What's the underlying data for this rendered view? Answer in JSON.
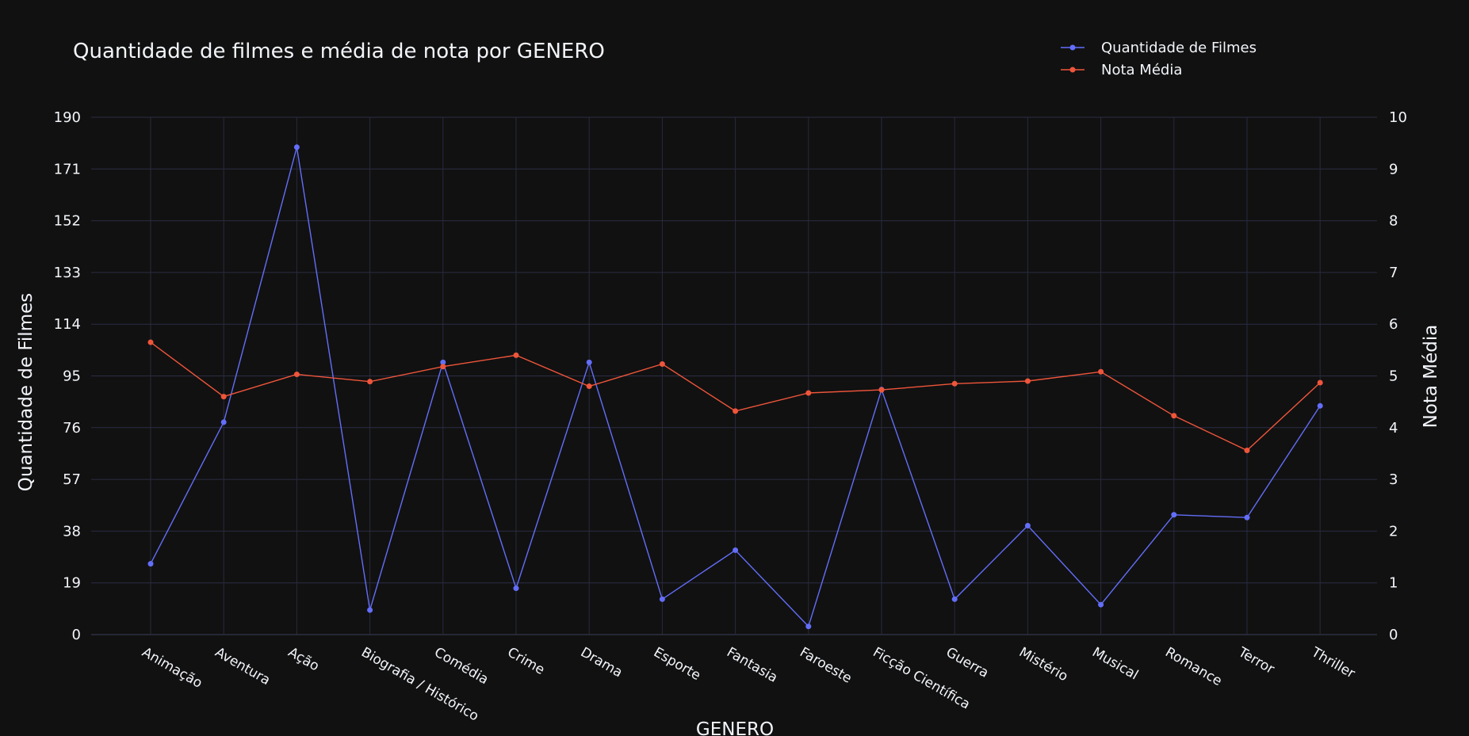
{
  "chart_data": {
    "type": "line",
    "title": "Quantidade de filmes e média de nota por GENERO",
    "xlabel": "GENERO",
    "ylabel": "Quantidade de Filmes",
    "y2label": "Nota Média",
    "categories": [
      "Animação",
      "Aventura",
      "Ação",
      "Biografia / Histórico",
      "Comédia",
      "Crime",
      "Drama",
      "Esporte",
      "Fantasia",
      "Faroeste",
      "Ficção Científica",
      "Guerra",
      "Mistério",
      "Musical",
      "Romance",
      "Terror",
      "Thriller"
    ],
    "yticks": [
      "0",
      "19",
      "38",
      "57",
      "76",
      "95",
      "114",
      "133",
      "152",
      "171",
      "190"
    ],
    "y2ticks": [
      "0",
      "1",
      "2",
      "3",
      "4",
      "5",
      "6",
      "7",
      "8",
      "9",
      "10"
    ],
    "ylim": [
      0,
      190
    ],
    "y2lim": [
      0,
      10
    ],
    "grid": true,
    "legend_position": "top-right",
    "series": [
      {
        "name": "Quantidade de Filmes",
        "axis": "left",
        "color": "#636efa",
        "values": [
          26,
          78,
          179,
          9,
          100,
          17,
          100,
          13,
          31,
          3,
          90,
          13,
          40,
          11,
          44,
          43,
          84
        ]
      },
      {
        "name": "Nota Média",
        "axis": "right",
        "color": "#ef553b",
        "values": [
          5.65,
          4.6,
          5.03,
          4.89,
          5.18,
          5.4,
          4.8,
          5.23,
          4.32,
          4.67,
          4.73,
          4.85,
          4.9,
          5.08,
          4.23,
          3.56,
          4.87
        ]
      }
    ]
  }
}
